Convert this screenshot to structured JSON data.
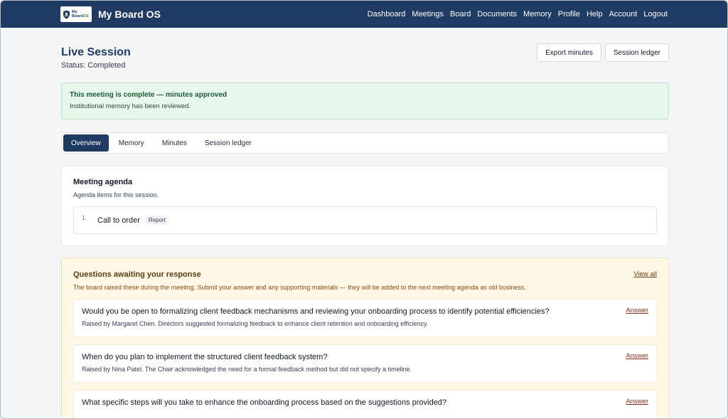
{
  "nav": {
    "logo_text_top": "My",
    "logo_text_bottom": "Board",
    "logo_text_os": "OS",
    "brand": "My Board OS",
    "links": [
      "Dashboard",
      "Meetings",
      "Board",
      "Documents",
      "Memory",
      "Profile",
      "Help",
      "Account",
      "Logout"
    ]
  },
  "header": {
    "title": "Live Session",
    "status": "Status: Completed",
    "export_button": "Export minutes",
    "ledger_button": "Session ledger"
  },
  "alert": {
    "title": "This meeting is complete — minutes approved",
    "body": "Institutional memory has been reviewed."
  },
  "tabs": [
    {
      "label": "Overview",
      "active": true
    },
    {
      "label": "Memory",
      "active": false
    },
    {
      "label": "Minutes",
      "active": false
    },
    {
      "label": "Session ledger",
      "active": false
    }
  ],
  "agenda": {
    "title": "Meeting agenda",
    "subtitle": "Agenda items for this session.",
    "items": [
      {
        "number": "1.",
        "label": "Call to order",
        "tag": "Report"
      }
    ]
  },
  "questions": {
    "title": "Questions awaiting your response",
    "description": "The board raised these during the meeting. Submit your answer and any supporting materials — they will be added to the next meeting agenda as old business.",
    "view_all": "View all",
    "answer_label": "Answer",
    "items": [
      {
        "question": "Would you be open to formalizing client feedback mechanisms and reviewing your onboarding process to identify potential efficiencies?",
        "meta": "Raised by Margaret Chen. Directors suggested formalizing feedback to enhance client retention and onboarding efficiency."
      },
      {
        "question": "When do you plan to implement the structured client feedback system?",
        "meta": "Raised by Nina Patel. The Chair acknowledged the need for a formal feedback method but did not specify a timeline."
      },
      {
        "question": "What specific steps will you take to enhance the onboarding process based on the suggestions provided?",
        "meta": ""
      }
    ]
  },
  "colors": {
    "nav_bg": "#1f3a63",
    "tab_active": "#1f3a63",
    "success_bg": "#e8f7ec",
    "questions_bg": "#fff8e6"
  }
}
